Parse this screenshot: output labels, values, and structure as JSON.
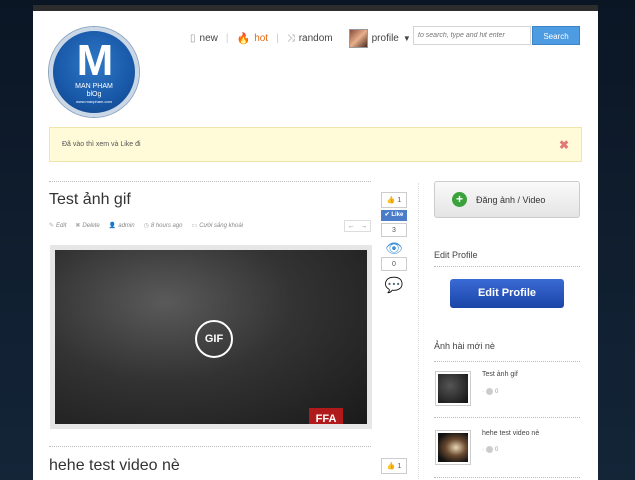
{
  "logo": {
    "letter": "M",
    "line1": "MAN PHAM",
    "line2": "blOg",
    "line3": "www.manpham.com"
  },
  "nav": {
    "new": "new",
    "hot": "hot",
    "random": "random",
    "profile": "profile"
  },
  "search": {
    "placeholder": "to search, type and hit enter",
    "button": "Search"
  },
  "notice": {
    "text": "Đã vào thì xem và Like đi",
    "close": "✖"
  },
  "posts": [
    {
      "title": "Test ảnh gif",
      "meta": {
        "edit": "Edit",
        "delete": "Delete",
        "author": "admin",
        "time": "8 hours ago",
        "category": "Cười sảng khoái"
      },
      "votes": "1",
      "like": "Like",
      "views": "3",
      "comments": "0",
      "media": {
        "badge": "GIF",
        "watermark": "FFA"
      }
    },
    {
      "title": "hehe test video nè",
      "votes": "1"
    }
  ],
  "sidebar": {
    "upload": "Đăng ảnh / Video",
    "edit_profile_heading": "Edit Profile",
    "edit_profile_button": "Edit Profile",
    "new_heading": "Ảnh hài mới nè",
    "items": [
      {
        "title": "Test ảnh gif",
        "count": "0"
      },
      {
        "title": "hehe test video nè",
        "count": "0"
      }
    ]
  },
  "arrows": {
    "prev": "←",
    "next": "→"
  }
}
